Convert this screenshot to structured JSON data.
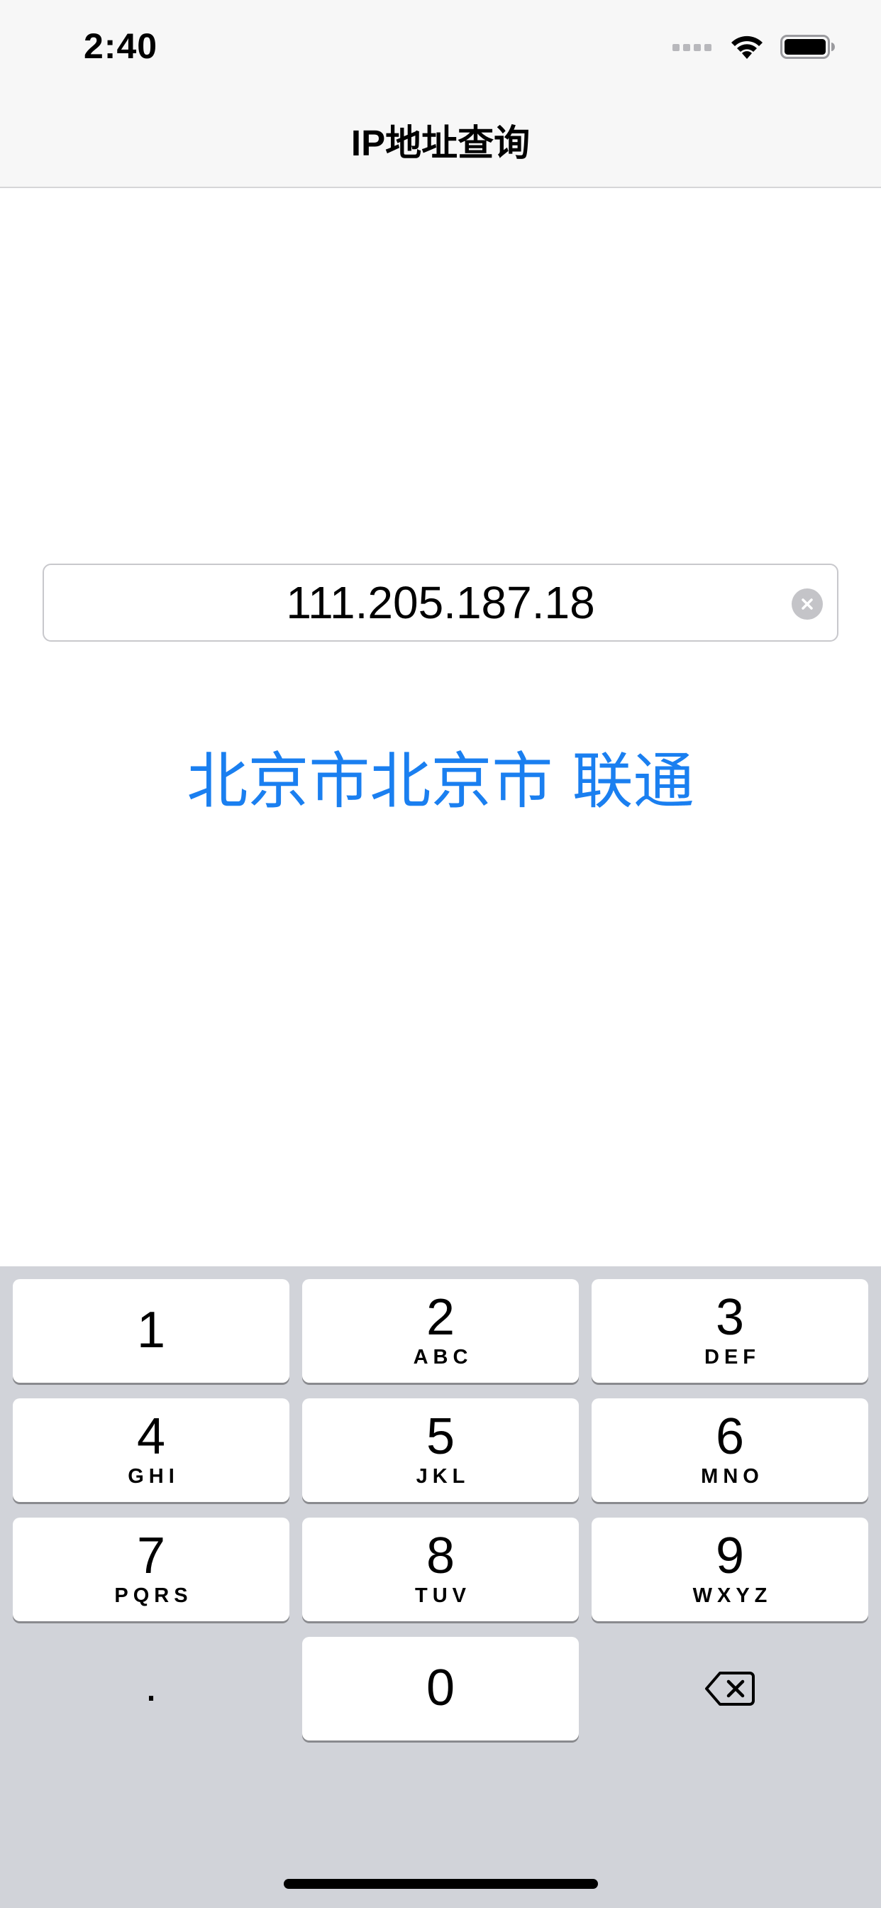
{
  "status_bar": {
    "time": "2:40",
    "icons": [
      "signal-icon",
      "wifi-icon",
      "battery-icon"
    ]
  },
  "nav": {
    "title": "IP地址查询"
  },
  "ip_field": {
    "value": "111.205.187.18",
    "clear_icon": "clear-icon"
  },
  "result": {
    "text": "北京市北京市 联通",
    "color": "#1a7ff0"
  },
  "keyboard": {
    "keys": [
      {
        "digit": "1",
        "letters": ""
      },
      {
        "digit": "2",
        "letters": "ABC"
      },
      {
        "digit": "3",
        "letters": "DEF"
      },
      {
        "digit": "4",
        "letters": "GHI"
      },
      {
        "digit": "5",
        "letters": "JKL"
      },
      {
        "digit": "6",
        "letters": "MNO"
      },
      {
        "digit": "7",
        "letters": "PQRS"
      },
      {
        "digit": "8",
        "letters": "TUV"
      },
      {
        "digit": "9",
        "letters": "WXYZ"
      }
    ],
    "dot": ".",
    "zero": "0",
    "delete_icon": "delete-icon"
  }
}
